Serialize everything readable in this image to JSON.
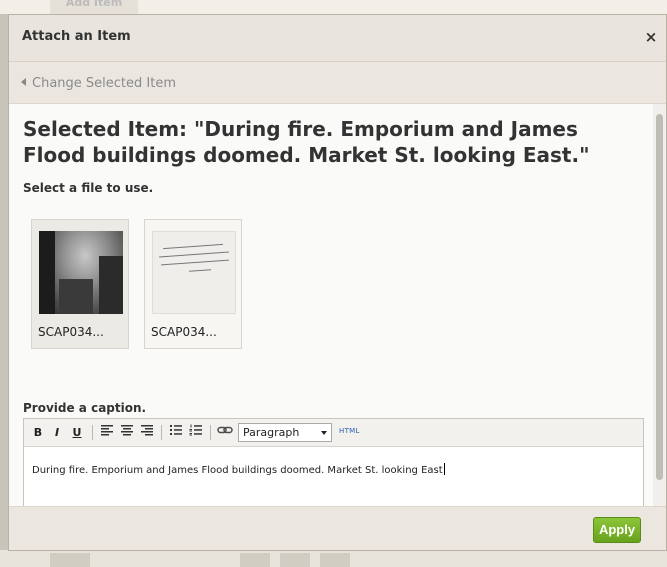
{
  "background": {
    "tab_label": "Add Item"
  },
  "modal": {
    "title": "Attach an Item",
    "close_glyph": "×"
  },
  "nav": {
    "change_label": "Change Selected Item"
  },
  "content": {
    "selected_title": "Selected Item: \"During fire. Emporium and James Flood buildings doomed. Market St. looking East.\"",
    "select_file_label": "Select a file to use.",
    "files": [
      {
        "name": "SCAP034...",
        "selected": true,
        "thumbnail": "photo"
      },
      {
        "name": "SCAP034...",
        "selected": false,
        "thumbnail": "document"
      }
    ],
    "caption_label": "Provide a caption."
  },
  "editor": {
    "toolbar": {
      "bold": "B",
      "italic": "I",
      "underline": "U",
      "format_value": "Paragraph",
      "html_label": "HTML"
    },
    "body_text": "During fire. Emporium and James Flood buildings doomed. Market St. looking East"
  },
  "footer": {
    "apply_label": "Apply"
  },
  "colors": {
    "apply": "#7ab22b",
    "link_html": "#2a5db0"
  }
}
